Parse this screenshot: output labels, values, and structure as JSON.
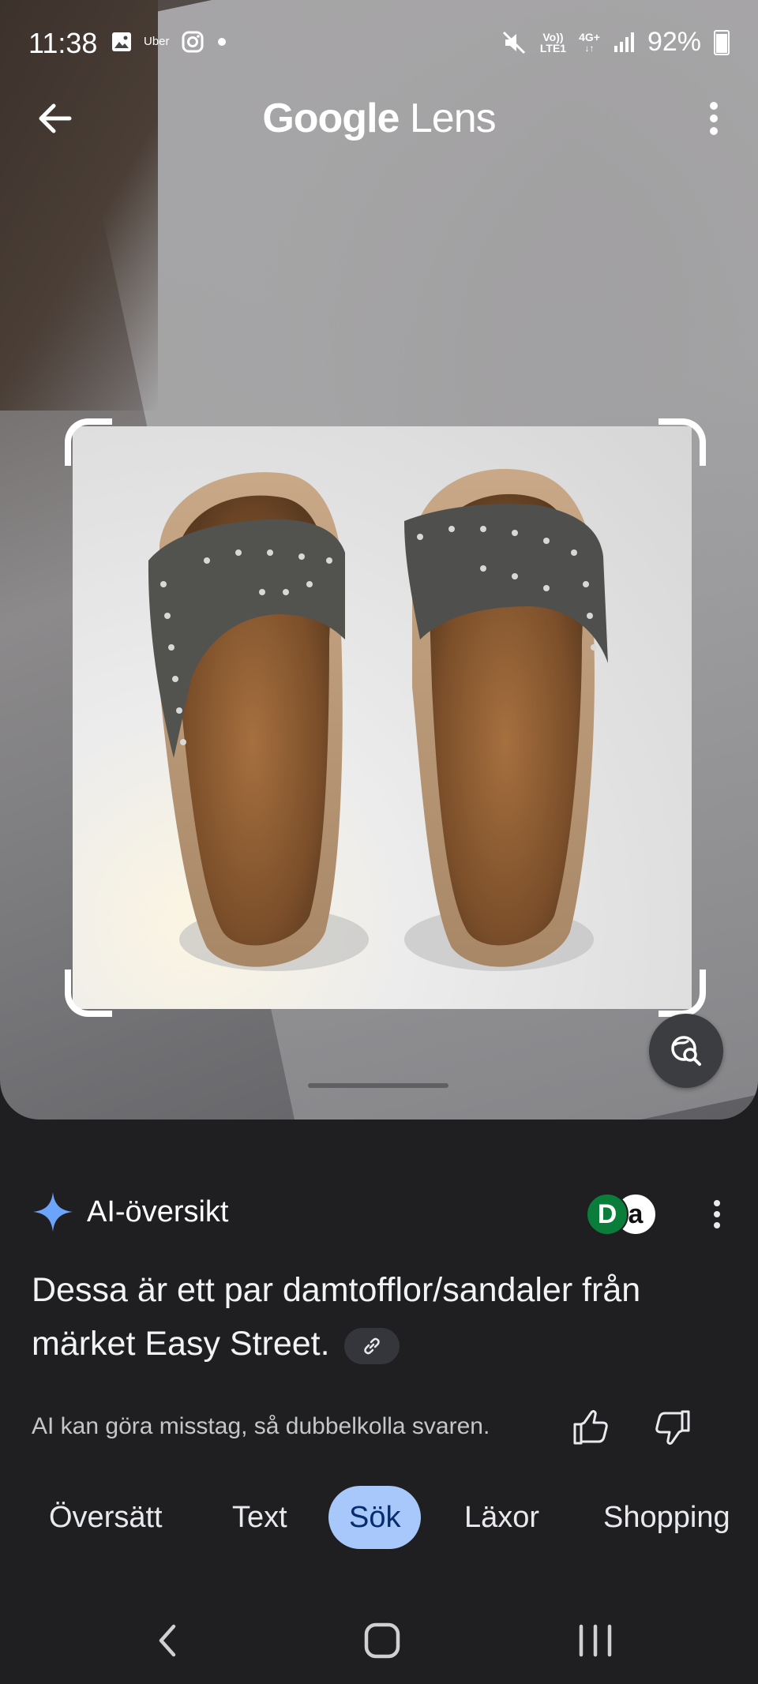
{
  "status_bar": {
    "time": "11:38",
    "uber_label": "Uber",
    "network_top": "Vo))",
    "network_bottom": "LTE1",
    "data_type": "4G+",
    "battery": "92%"
  },
  "app_bar": {
    "title_brand": "Google",
    "title_product": " Lens"
  },
  "ai_overview": {
    "title": "AI-översikt",
    "source_d_letter": "D",
    "source_a_letter": "a",
    "answer_line1": "Dessa är ett par damtofflor/sandaler från",
    "answer_line2": "märket Easy Street.",
    "disclaimer": "AI kan göra misstag, så dubbelkolla svaren."
  },
  "tabs": [
    {
      "label": "Översätt"
    },
    {
      "label": "Text"
    },
    {
      "label": "Sök",
      "selected": true
    },
    {
      "label": "Läxor"
    },
    {
      "label": "Shopping"
    }
  ],
  "colors": {
    "active_tab_bg": "#a8c7fa",
    "sheet_bg": "#1f1f21",
    "spark_blue": "#6ba4f8"
  }
}
